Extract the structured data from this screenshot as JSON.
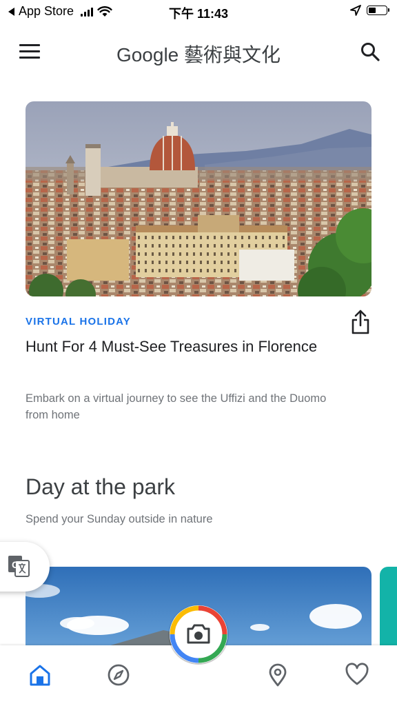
{
  "status_bar": {
    "back_app": "App Store",
    "time": "下午 11:43",
    "battery_level": 0.45
  },
  "app_bar": {
    "title": "Google 藝術與文化"
  },
  "story": {
    "eyebrow": "VIRTUAL HOLIDAY",
    "title": "Hunt For 4 Must-See Treasures in Florence",
    "description": "Embark on a virtual journey to see the Uffizi and the Duomo from home"
  },
  "section": {
    "title": "Day at the park",
    "subtitle": "Spend your Sunday outside in nature"
  },
  "colors": {
    "accent_blue": "#1a73e8",
    "google_red": "#ea4335",
    "google_yellow": "#fbbc04",
    "google_green": "#34a853",
    "teal_card": "#13b3a8"
  },
  "icons": {
    "menu": "menu-icon",
    "search": "search-icon",
    "share": "share-icon",
    "translate": "translate-icon",
    "camera": "camera-icon",
    "home": "home-icon",
    "explore": "compass-icon",
    "nearby": "location-pin-icon",
    "favorites": "heart-icon"
  }
}
